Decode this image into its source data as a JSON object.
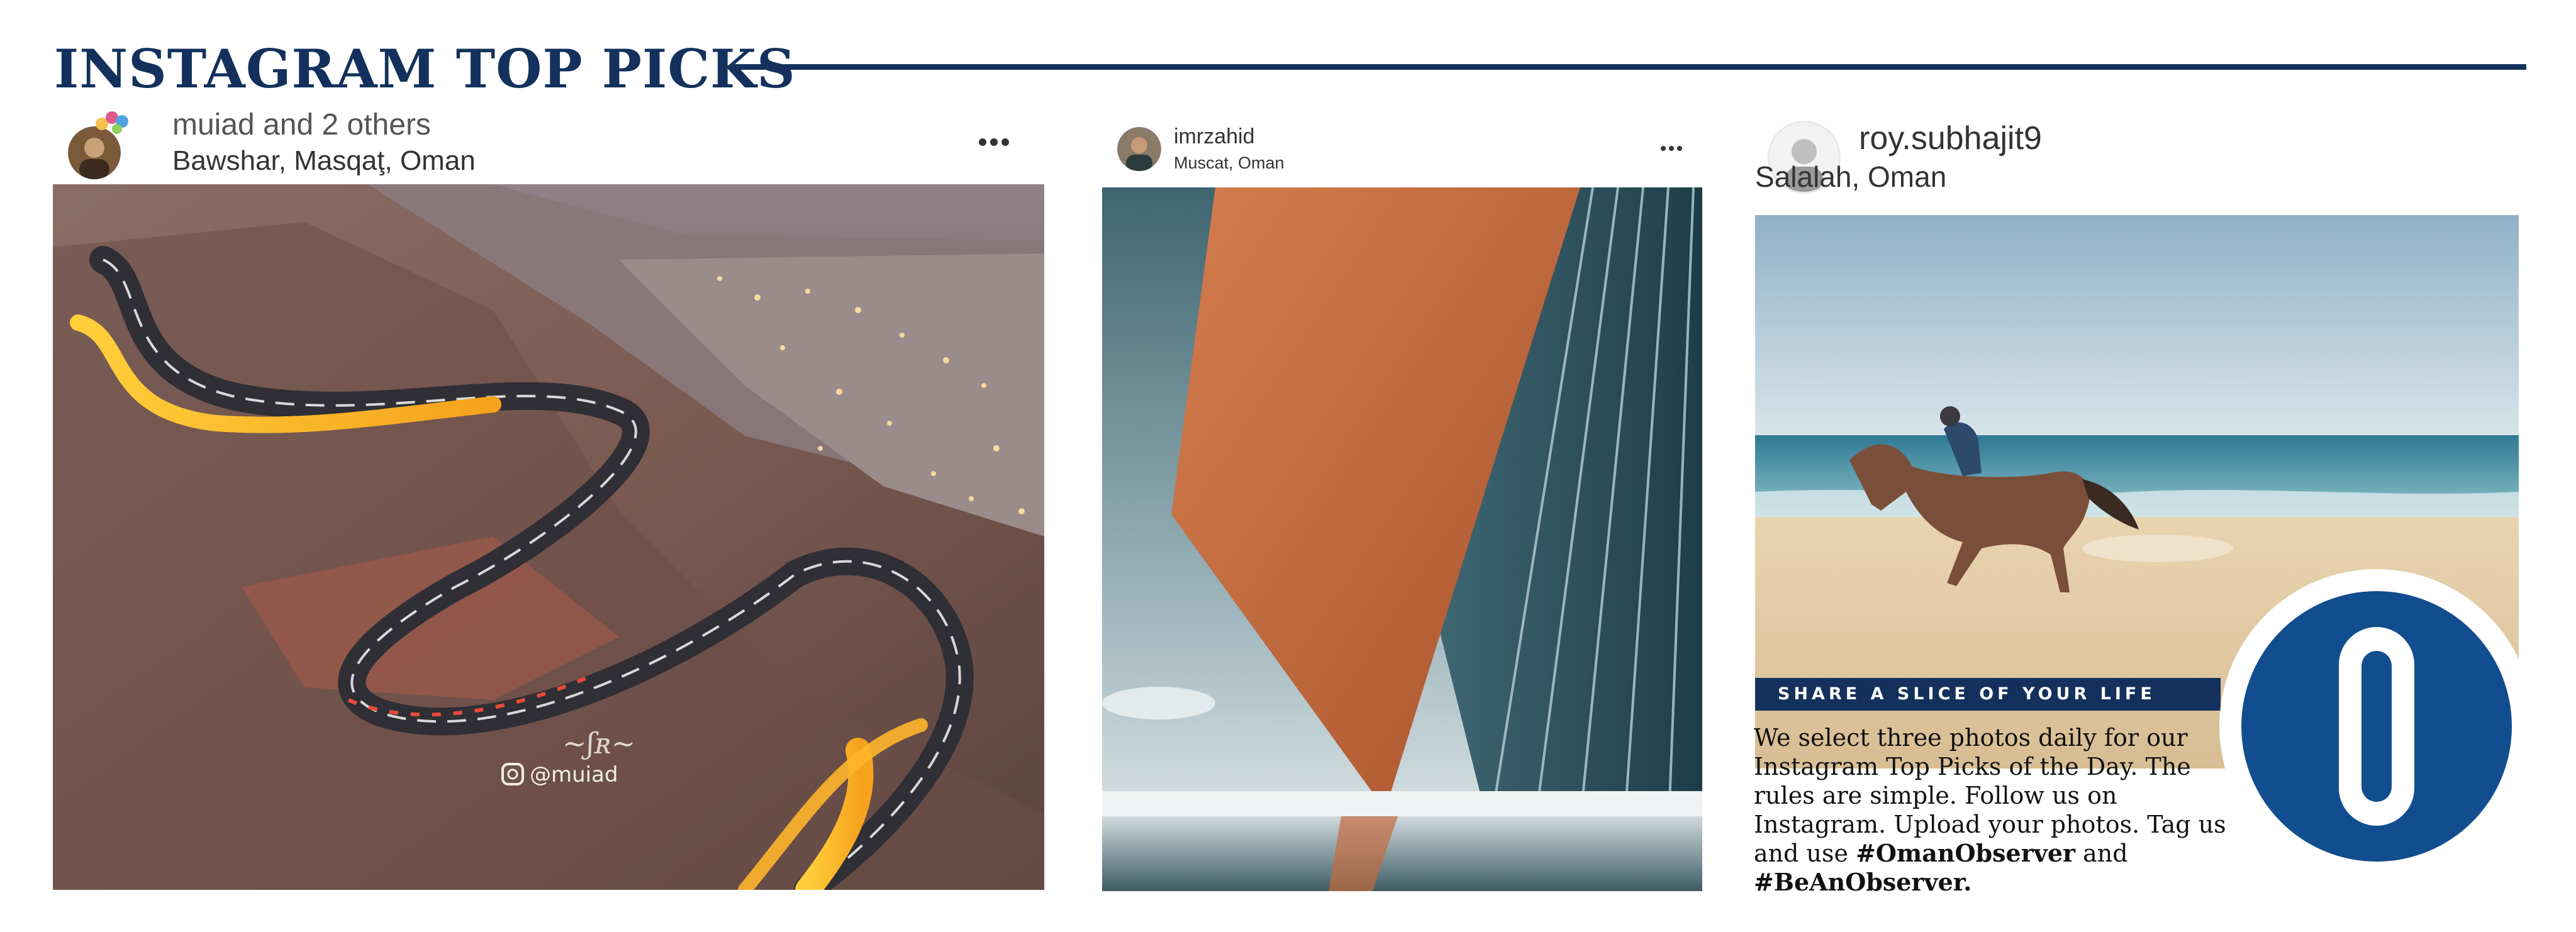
{
  "header": {
    "title": "INSTAGRAM TOP PICKS"
  },
  "posts": [
    {
      "username": "muiad",
      "username_suffix": " and 2 others",
      "location": "Bawshar, Masqaţ, Oman",
      "watermark_handle": "@muiad",
      "photo_subject": "winding-mountain-road-night-icon"
    },
    {
      "username": "imrzahid",
      "location": "Muscat, Oman",
      "photo_subject": "copper-building-reflection-icon"
    },
    {
      "username": "roy.subhajit9",
      "location": "Salalah, Oman",
      "photo_subject": "horse-rider-beach-icon"
    }
  ],
  "share": {
    "banner": "SHARE A SLICE OF YOUR LIFE",
    "body_line": "We select three photos daily for our Instagram Top Picks of the Day. The rules are simple. Follow us on Instagram. Upload your photos. Tag us and use ",
    "hashtag_1": "#OmanObserver",
    "connector": " and ",
    "hashtag_2": "#BeAnObserver."
  },
  "colors": {
    "brand_navy": "#13315c",
    "logo_blue": "#124d8f"
  },
  "icons": {
    "more": "more-options-icon",
    "logo": "oman-observer-logo-icon"
  }
}
